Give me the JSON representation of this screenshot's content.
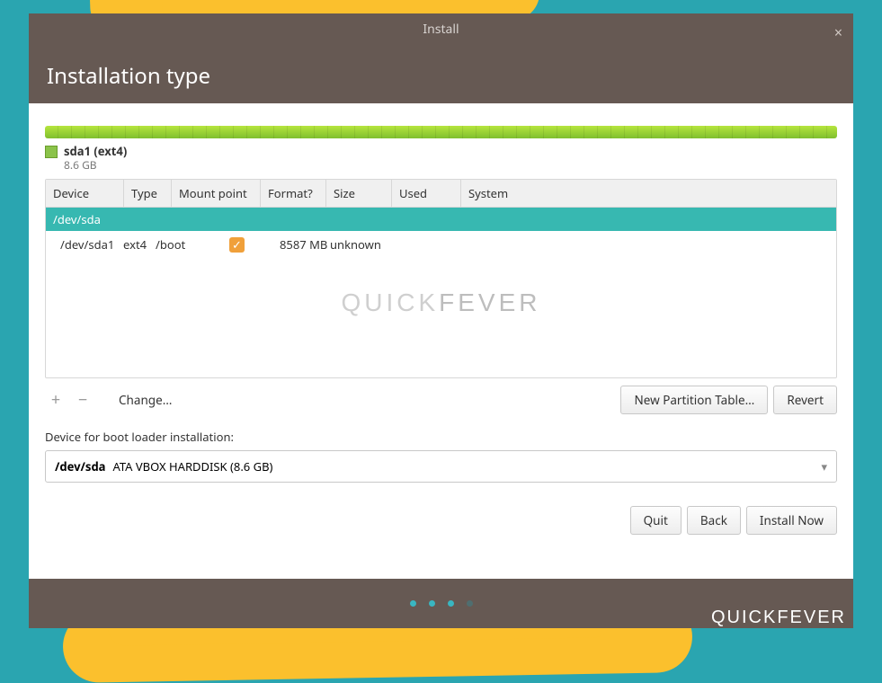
{
  "window": {
    "title": "Install",
    "close_glyph": "×"
  },
  "page": {
    "title": "Installation type"
  },
  "legend": {
    "title": "sda1 (ext4)",
    "size": "8.6 GB"
  },
  "table": {
    "headers": {
      "device": "Device",
      "type": "Type",
      "mount": "Mount point",
      "format": "Format?",
      "size": "Size",
      "used": "Used",
      "system": "System"
    },
    "group": "/dev/sda",
    "row": {
      "device": "/dev/sda1",
      "type": "ext4",
      "mount": "/boot",
      "format_checked": true,
      "size": "8587 MB",
      "used": "unknown",
      "system": ""
    }
  },
  "watermark": {
    "light": "QUICK",
    "heavy": "FEVER"
  },
  "toolbar": {
    "add_glyph": "+",
    "remove_glyph": "−",
    "change": "Change…",
    "new_table": "New Partition Table…",
    "revert": "Revert"
  },
  "bootloader": {
    "label": "Device for boot loader installation:",
    "device": "/dev/sda",
    "desc": "ATA VBOX HARDDISK (8.6 GB)",
    "caret": "▾"
  },
  "nav": {
    "quit": "Quit",
    "back": "Back",
    "install": "Install Now"
  },
  "checkmark": "✓",
  "brand": {
    "light": "QUICK",
    "heavy": "FEVER"
  }
}
